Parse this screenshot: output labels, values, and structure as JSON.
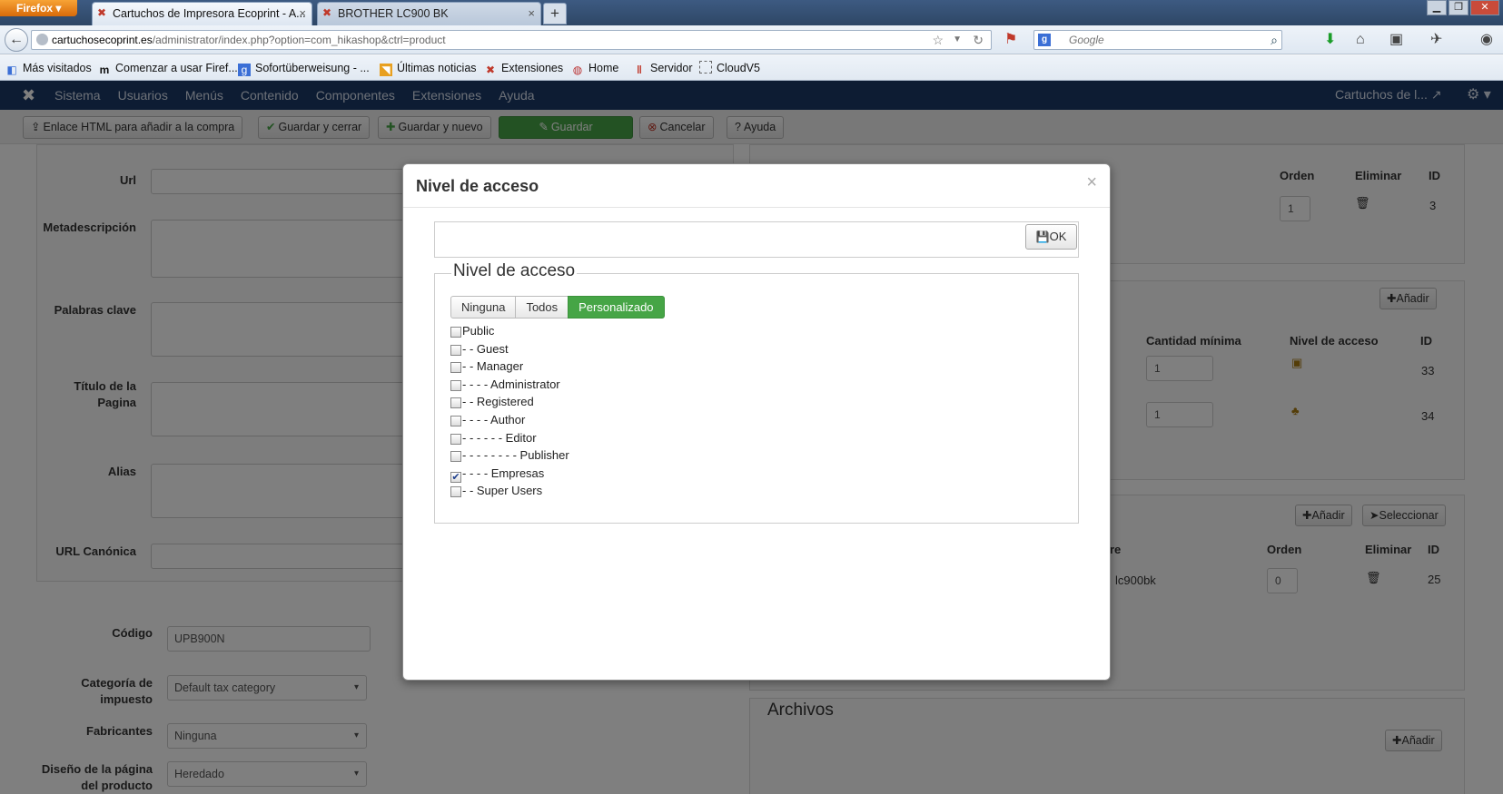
{
  "browser": {
    "menu_button": "Firefox",
    "tabs": [
      {
        "title": "Cartuchos de Impresora Ecoprint - A...",
        "active": true
      },
      {
        "title": "BROTHER LC900 BK",
        "active": false
      }
    ],
    "url_host": "cartuchosecoprint.es",
    "url_path": "/administrator/index.php?option=com_hikashop&ctrl=product",
    "search_placeholder": "Google",
    "bookmarks": [
      "Más visitados",
      "Comenzar a usar Firef...",
      "Sofortüberweisung - ...",
      "Últimas noticias",
      "Extensiones",
      "Home",
      "Servidor",
      "CloudV5"
    ]
  },
  "admin": {
    "menu": [
      "Sistema",
      "Usuarios",
      "Menús",
      "Contenido",
      "Componentes",
      "Extensiones",
      "Ayuda"
    ],
    "site_name": "Cartuchos de l...",
    "toolbar": {
      "html_link": "Enlace HTML para añadir a la compra",
      "save_close": "Guardar y cerrar",
      "save_new": "Guardar y nuevo",
      "save": "Guardar",
      "cancel": "Cancelar",
      "help": "Ayuda"
    },
    "form_labels": {
      "url": "Url",
      "meta_description": "Metadescripción",
      "keywords": "Palabras clave",
      "page_title_1": "Título de la",
      "page_title_2": "Pagina",
      "alias": "Alias",
      "canonical": "URL Canónica",
      "code": "Código",
      "tax_1": "Categoría de",
      "tax_2": "impuesto",
      "manufacturers": "Fabricantes",
      "design_1": "Diseño de la página",
      "design_2": "del producto"
    },
    "form_values": {
      "code": "UPB900N",
      "tax": "Default tax category",
      "manufacturer": "Ninguna",
      "design": "Heredado"
    },
    "right": {
      "cat_headers": {
        "order": "Orden",
        "delete": "Eliminar",
        "id": "ID"
      },
      "cat_row": {
        "order": "1",
        "id": "3"
      },
      "add": "Añadir",
      "price_headers": {
        "min_qty": "Cantidad mínima",
        "access": "Nivel de acceso",
        "id": "ID"
      },
      "price_rows": [
        {
          "qty": "1",
          "id": "33"
        },
        {
          "qty": "1",
          "id": "34"
        }
      ],
      "select": "Seleccionar",
      "related_headers": {
        "name": "re",
        "order": "Orden",
        "delete": "Eliminar",
        "id": "ID"
      },
      "related_row": {
        "name": "lc900bk",
        "order": "0",
        "id": "25"
      },
      "files_title": "Archivos"
    }
  },
  "modal": {
    "title": "Nivel de acceso",
    "close": "×",
    "ok": "OK",
    "legend": "Nivel de acceso",
    "segments": [
      {
        "label": "Ninguna",
        "active": false
      },
      {
        "label": "Todos",
        "active": false
      },
      {
        "label": "Personalizado",
        "active": true
      }
    ],
    "groups": [
      {
        "label": "Public",
        "checked": false
      },
      {
        "label": "- - Guest",
        "checked": false
      },
      {
        "label": "- - Manager",
        "checked": false
      },
      {
        "label": "- - - - Administrator",
        "checked": false
      },
      {
        "label": "- - Registered",
        "checked": false
      },
      {
        "label": "- - - - Author",
        "checked": false
      },
      {
        "label": "- - - - - - Editor",
        "checked": false
      },
      {
        "label": "- - - - - - - - Publisher",
        "checked": false
      },
      {
        "label": "- - - - Empresas",
        "checked": true
      },
      {
        "label": "- - Super Users",
        "checked": false
      }
    ]
  }
}
